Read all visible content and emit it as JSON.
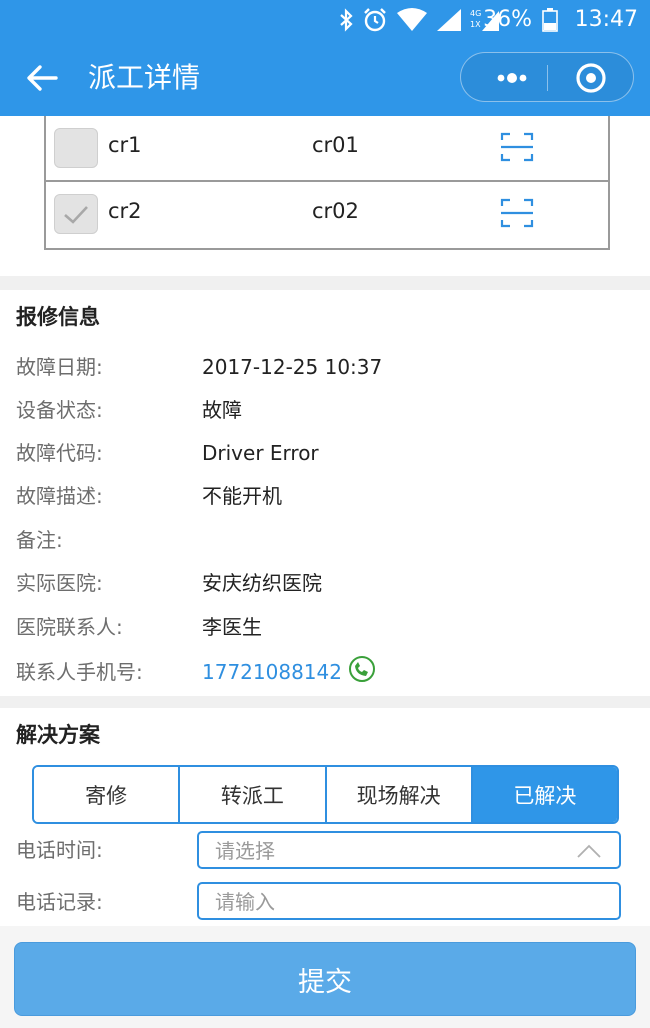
{
  "status_bar": {
    "battery_pct": "36%",
    "time": "13:47",
    "icons": [
      "bluetooth-icon",
      "alarm-icon",
      "wifi-icon",
      "signal-icon",
      "4g-signal-icon",
      "battery-icon"
    ]
  },
  "nav": {
    "title": "派工详情",
    "back_icon": "arrow-left-icon",
    "more_icon": "more-dots-icon",
    "close_icon": "target-circle-icon"
  },
  "devices": [
    {
      "name": "cr1",
      "code": "cr01",
      "checked": false
    },
    {
      "name": "cr2",
      "code": "cr02",
      "checked": true
    }
  ],
  "repair_info": {
    "title": "报修信息",
    "fields": [
      {
        "label": "故障日期:",
        "value": "2017-12-25 10:37"
      },
      {
        "label": "设备状态:",
        "value": "故障"
      },
      {
        "label": "故障代码:",
        "value": "Driver Error"
      },
      {
        "label": "故障描述:",
        "value": "不能开机"
      },
      {
        "label": "备注:",
        "value": ""
      },
      {
        "label": "实际医院:",
        "value": "安庆纺织医院"
      },
      {
        "label": "医院联系人:",
        "value": "李医生"
      },
      {
        "label": "联系人手机号:",
        "value": "17721088142"
      }
    ]
  },
  "solution": {
    "title": "解决方案",
    "options": [
      {
        "label": "寄修",
        "active": false
      },
      {
        "label": "转派工",
        "active": false
      },
      {
        "label": "现场解决",
        "active": false
      },
      {
        "label": "已解决",
        "active": true
      }
    ],
    "call_time": {
      "label": "电话时间:",
      "placeholder": "请选择"
    },
    "call_record": {
      "label": "电话记录:",
      "placeholder": "请输入"
    }
  },
  "submit_label": "提交",
  "colors": {
    "primary": "#2f96e8",
    "link": "#2f8fe0",
    "submit": "#5aaae8",
    "phone_icon": "#3aa03a"
  }
}
